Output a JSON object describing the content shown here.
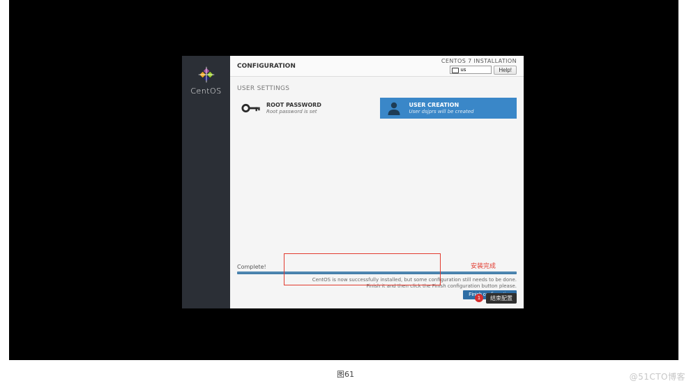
{
  "sidebar": {
    "brand": "CentOS"
  },
  "topbar": {
    "title": "CONFIGURATION",
    "installation": "CENTOS 7 INSTALLATION",
    "keyboard": "us",
    "help_label": "Help!"
  },
  "sections": {
    "user_settings_heading": "USER SETTINGS",
    "root": {
      "title": "ROOT PASSWORD",
      "subtitle": "Root password is set"
    },
    "user": {
      "title": "USER CREATION",
      "subtitle": "User dsjprs will be created"
    }
  },
  "progress": {
    "status": "Complete!",
    "annot_cn": "安装完成",
    "msg_line1": "CentOS is now successfully installed, but some configuration still needs to be done.",
    "msg_line2": "Finish it and then click the Finish configuration button please.",
    "finish_label": "Finish configuration",
    "badge": "1",
    "tip_cn": "结束配置"
  },
  "caption": "图61",
  "watermark": "@51CTO博客"
}
